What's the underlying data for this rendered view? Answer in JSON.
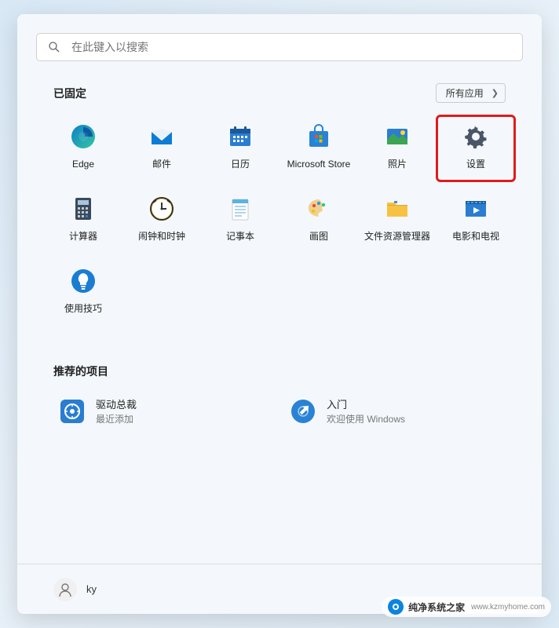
{
  "search": {
    "placeholder": "在此键入以搜索"
  },
  "pinned": {
    "title": "已固定",
    "all_apps_label": "所有应用",
    "apps": [
      {
        "label": "Edge",
        "icon": "edge"
      },
      {
        "label": "邮件",
        "icon": "mail"
      },
      {
        "label": "日历",
        "icon": "calendar"
      },
      {
        "label": "Microsoft Store",
        "icon": "store"
      },
      {
        "label": "照片",
        "icon": "photos"
      },
      {
        "label": "设置",
        "icon": "settings",
        "highlighted": true
      },
      {
        "label": "计算器",
        "icon": "calculator"
      },
      {
        "label": "闹钟和时钟",
        "icon": "clock"
      },
      {
        "label": "记事本",
        "icon": "notepad"
      },
      {
        "label": "画图",
        "icon": "paint"
      },
      {
        "label": "文件资源管理器",
        "icon": "explorer"
      },
      {
        "label": "电影和电视",
        "icon": "movies"
      },
      {
        "label": "使用技巧",
        "icon": "tips"
      }
    ]
  },
  "recommended": {
    "title": "推荐的项目",
    "items": [
      {
        "title": "驱动总裁",
        "subtitle": "最近添加",
        "icon": "driver"
      },
      {
        "title": "入门",
        "subtitle": "欢迎使用 Windows",
        "icon": "getstarted"
      }
    ]
  },
  "user": {
    "name": "ky"
  },
  "watermark": {
    "text": "纯净系统之家",
    "url": "www.kzmyhome.com"
  }
}
